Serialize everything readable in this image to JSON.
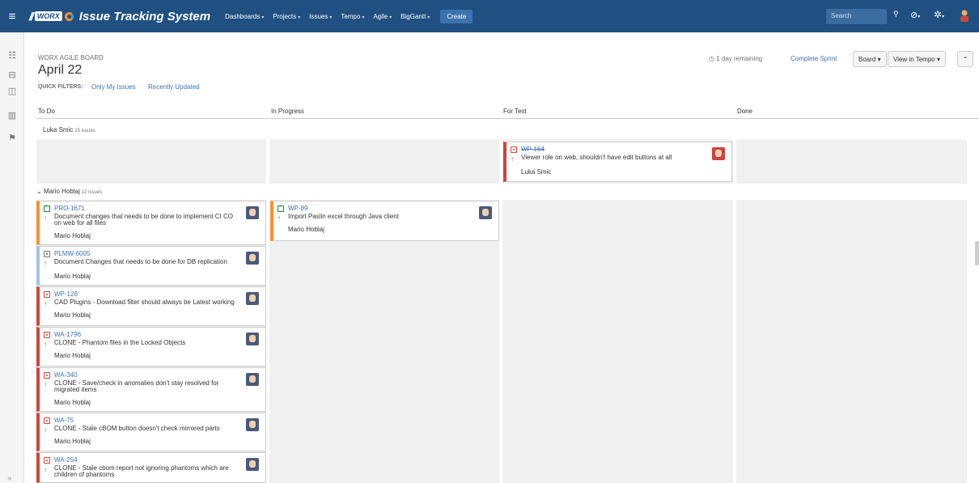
{
  "topnav": {
    "slashes": "//",
    "logo_text": "WORX",
    "title": "Issue Tracking System",
    "menu": [
      "Dashboards",
      "Projects",
      "Issues",
      "Tempo",
      "Agile",
      "BigGantt"
    ],
    "create_label": "Create",
    "search_placeholder": "Search"
  },
  "header": {
    "board_name": "WORX AGILE BOARD",
    "sprint_title": "April 22",
    "quick_filters_label": "QUICK FILTERS:",
    "quick_filters": [
      "Only My Issues",
      "Recently Updated"
    ],
    "remaining": "1 day remaining",
    "complete_sprint": "Complete Sprint",
    "board_button": "Board",
    "tempo_button": "View in Tempo",
    "collapse_button": "»"
  },
  "columns": [
    "To Do",
    "In Progress",
    "For Test",
    "Done"
  ],
  "swimlanes": [
    {
      "name": "Luka Smic",
      "count": "15 issues"
    },
    {
      "name": "Mario Hoblaj",
      "count": "12 issues"
    }
  ],
  "cards": [
    {
      "key": "WP-164",
      "summary": "Viewer role on web, shouldn't have edit buttons at all",
      "assignee": "Luka Smic"
    },
    {
      "key": "PRO-1671",
      "summary": "Document changes that needs to be done to implement CI CO on web for all files",
      "assignee": "Mario Hoblaj"
    },
    {
      "key": "WP-89",
      "summary": "Import Paslin excel through Java client",
      "assignee": "Mario Hoblaj"
    },
    {
      "key": "PLMW-6005",
      "summary": "Document Changes that needs to be done for DB replication",
      "assignee": "Mario Hoblaj"
    },
    {
      "key": "WP-126",
      "summary": "CAD Plugins - Download filter should always be Latest working",
      "assignee": "Mario Hoblaj"
    },
    {
      "key": "WA-1796",
      "summary": "CLONE - Phantom files in the Locked Objects",
      "assignee": "Mario Hoblaj"
    },
    {
      "key": "WA-340",
      "summary": "CLONE - Save/check in anomalies don't stay resolved for migrated items",
      "assignee": "Mario Hoblaj"
    },
    {
      "key": "WA-75",
      "summary": "CLONE - Stale cBOM button doesn't check mirrored parts",
      "assignee": "Mario Hoblaj"
    },
    {
      "key": "WA-254",
      "summary": "CLONE - Stale cbom report not ignoring phantoms which are children of phantoms",
      "assignee": ""
    }
  ],
  "colors": {
    "nav": "#205081",
    "link": "#3b73af",
    "bug": "#d04437",
    "story": "#f79232",
    "task": "#9dc6ea"
  }
}
